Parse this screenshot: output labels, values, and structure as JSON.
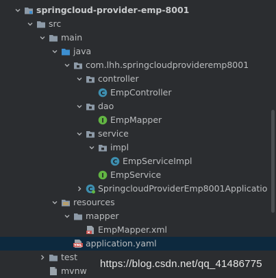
{
  "tree": [
    {
      "label": "springcloud-provider-emp-8001",
      "icon": "module-folder-icon",
      "expanded": true,
      "bold": true
    },
    {
      "label": "src",
      "icon": "folder-icon",
      "expanded": true
    },
    {
      "label": "main",
      "icon": "folder-icon",
      "expanded": true
    },
    {
      "label": "java",
      "icon": "source-root-folder-icon",
      "expanded": true
    },
    {
      "label": "com.lhh.springcloudprovideremp8001",
      "icon": "package-icon",
      "expanded": true
    },
    {
      "label": "controller",
      "icon": "package-icon",
      "expanded": true
    },
    {
      "label": "EmpController",
      "icon": "class-icon"
    },
    {
      "label": "dao",
      "icon": "package-icon",
      "expanded": true
    },
    {
      "label": "EmpMapper",
      "icon": "interface-icon"
    },
    {
      "label": "service",
      "icon": "package-icon",
      "expanded": true
    },
    {
      "label": "impl",
      "icon": "package-icon",
      "expanded": true
    },
    {
      "label": "EmpServiceImpl",
      "icon": "class-icon"
    },
    {
      "label": "EmpService",
      "icon": "interface-icon"
    },
    {
      "label": "SpringcloudProviderEmp8001Applicatio",
      "icon": "spring-boot-class-icon",
      "expanded": false
    },
    {
      "label": "resources",
      "icon": "resources-folder-icon",
      "expanded": true
    },
    {
      "label": "mapper",
      "icon": "folder-icon",
      "expanded": true
    },
    {
      "label": "EmpMapper.xml",
      "icon": "xml-file-icon"
    },
    {
      "label": "application.yaml",
      "icon": "yaml-file-icon",
      "selected": true
    },
    {
      "label": "test",
      "icon": "folder-icon",
      "expanded": false
    },
    {
      "label": "mvnw",
      "icon": "file-icon"
    }
  ],
  "icon_texts": {
    "class": "C",
    "interface": "I",
    "yaml": "YML"
  },
  "watermark": "https://blog.csdn.net/qq_41486775",
  "colors": {
    "background": "#2b2d30",
    "selection": "#0d293e",
    "folder": "#8d9aa7",
    "source_root": "#3d8fd1",
    "class": "#3e8fb0",
    "interface": "#62b543",
    "text": "#bbbdbf"
  }
}
